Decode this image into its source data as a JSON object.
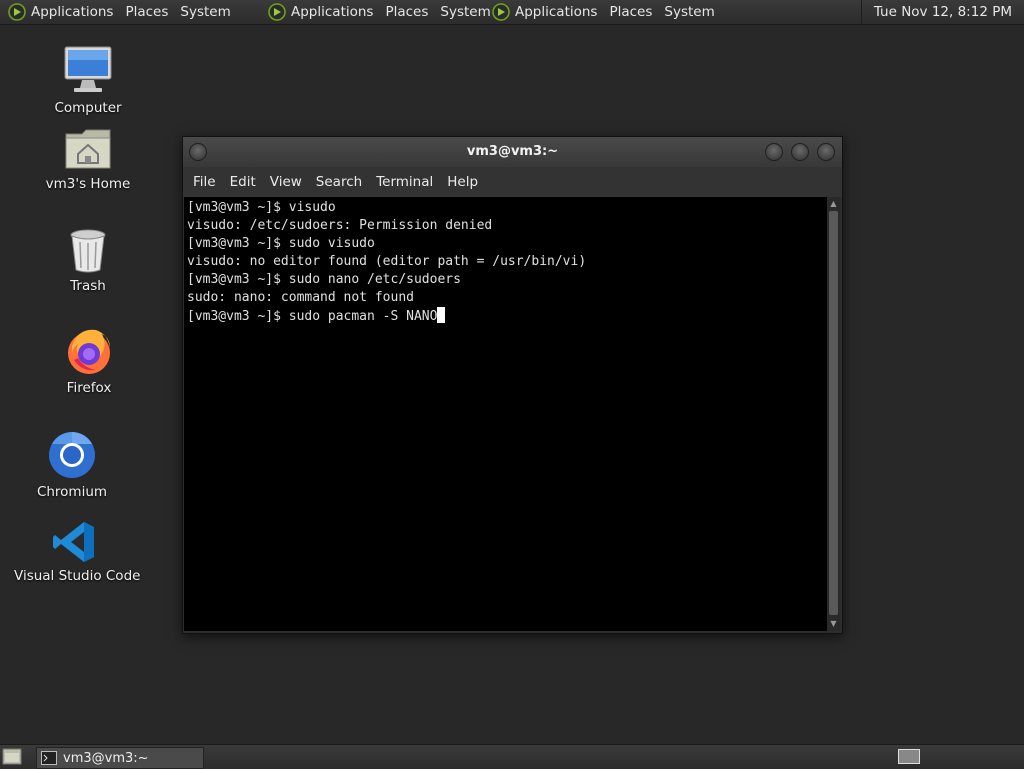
{
  "top_panel": {
    "groups": [
      {
        "items": [
          "Applications",
          "Places",
          "System"
        ]
      },
      {
        "items": [
          "Applications",
          "Places",
          "System"
        ]
      },
      {
        "items": [
          "Applications",
          "Places",
          "System"
        ]
      }
    ],
    "clock": "Tue Nov 12,  8:12 PM"
  },
  "desktop_icons": [
    {
      "label": "Computer",
      "icon": "computer-icon"
    },
    {
      "label": "vm3's Home",
      "icon": "home-folder-icon"
    },
    {
      "label": "Trash",
      "icon": "trash-icon"
    },
    {
      "label": "Firefox",
      "icon": "firefox-icon"
    },
    {
      "label": "Chromium",
      "icon": "chromium-icon"
    },
    {
      "label": "Visual Studio Code",
      "icon": "vscode-icon"
    }
  ],
  "terminal": {
    "title": "vm3@vm3:~",
    "menu": [
      "File",
      "Edit",
      "View",
      "Search",
      "Terminal",
      "Help"
    ],
    "lines": [
      "[vm3@vm3 ~]$ visudo",
      "visudo: /etc/sudoers: Permission denied",
      "[vm3@vm3 ~]$ sudo visudo",
      "visudo: no editor found (editor path = /usr/bin/vi)",
      "[vm3@vm3 ~]$ sudo nano /etc/sudoers",
      "sudo: nano: command not found",
      "[vm3@vm3 ~]$ sudo pacman -S NANO"
    ]
  },
  "taskbar": {
    "task_label": "vm3@vm3:~"
  },
  "colors": {
    "desktop": "#282828",
    "panel": "#333333",
    "terminal_bg": "#000000",
    "logo_green": "#6ea020"
  }
}
